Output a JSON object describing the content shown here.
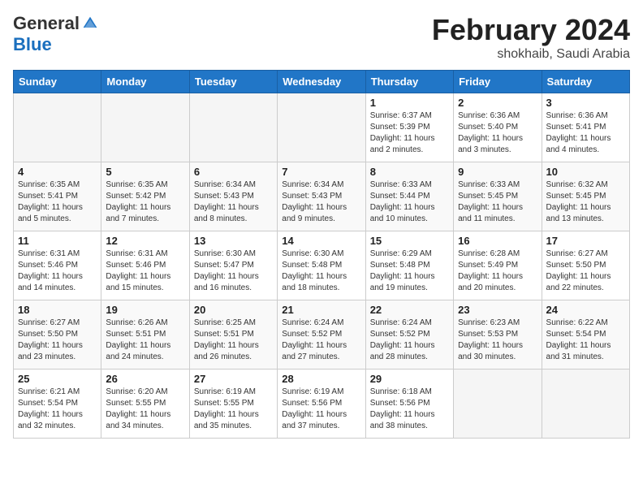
{
  "header": {
    "logo_general": "General",
    "logo_blue": "Blue",
    "title": "February 2024",
    "location": "shokhaib, Saudi Arabia"
  },
  "weekdays": [
    "Sunday",
    "Monday",
    "Tuesday",
    "Wednesday",
    "Thursday",
    "Friday",
    "Saturday"
  ],
  "weeks": [
    [
      {
        "day": "",
        "info": ""
      },
      {
        "day": "",
        "info": ""
      },
      {
        "day": "",
        "info": ""
      },
      {
        "day": "",
        "info": ""
      },
      {
        "day": "1",
        "info": "Sunrise: 6:37 AM\nSunset: 5:39 PM\nDaylight: 11 hours and 2 minutes."
      },
      {
        "day": "2",
        "info": "Sunrise: 6:36 AM\nSunset: 5:40 PM\nDaylight: 11 hours and 3 minutes."
      },
      {
        "day": "3",
        "info": "Sunrise: 6:36 AM\nSunset: 5:41 PM\nDaylight: 11 hours and 4 minutes."
      }
    ],
    [
      {
        "day": "4",
        "info": "Sunrise: 6:35 AM\nSunset: 5:41 PM\nDaylight: 11 hours and 5 minutes."
      },
      {
        "day": "5",
        "info": "Sunrise: 6:35 AM\nSunset: 5:42 PM\nDaylight: 11 hours and 7 minutes."
      },
      {
        "day": "6",
        "info": "Sunrise: 6:34 AM\nSunset: 5:43 PM\nDaylight: 11 hours and 8 minutes."
      },
      {
        "day": "7",
        "info": "Sunrise: 6:34 AM\nSunset: 5:43 PM\nDaylight: 11 hours and 9 minutes."
      },
      {
        "day": "8",
        "info": "Sunrise: 6:33 AM\nSunset: 5:44 PM\nDaylight: 11 hours and 10 minutes."
      },
      {
        "day": "9",
        "info": "Sunrise: 6:33 AM\nSunset: 5:45 PM\nDaylight: 11 hours and 11 minutes."
      },
      {
        "day": "10",
        "info": "Sunrise: 6:32 AM\nSunset: 5:45 PM\nDaylight: 11 hours and 13 minutes."
      }
    ],
    [
      {
        "day": "11",
        "info": "Sunrise: 6:31 AM\nSunset: 5:46 PM\nDaylight: 11 hours and 14 minutes."
      },
      {
        "day": "12",
        "info": "Sunrise: 6:31 AM\nSunset: 5:46 PM\nDaylight: 11 hours and 15 minutes."
      },
      {
        "day": "13",
        "info": "Sunrise: 6:30 AM\nSunset: 5:47 PM\nDaylight: 11 hours and 16 minutes."
      },
      {
        "day": "14",
        "info": "Sunrise: 6:30 AM\nSunset: 5:48 PM\nDaylight: 11 hours and 18 minutes."
      },
      {
        "day": "15",
        "info": "Sunrise: 6:29 AM\nSunset: 5:48 PM\nDaylight: 11 hours and 19 minutes."
      },
      {
        "day": "16",
        "info": "Sunrise: 6:28 AM\nSunset: 5:49 PM\nDaylight: 11 hours and 20 minutes."
      },
      {
        "day": "17",
        "info": "Sunrise: 6:27 AM\nSunset: 5:50 PM\nDaylight: 11 hours and 22 minutes."
      }
    ],
    [
      {
        "day": "18",
        "info": "Sunrise: 6:27 AM\nSunset: 5:50 PM\nDaylight: 11 hours and 23 minutes."
      },
      {
        "day": "19",
        "info": "Sunrise: 6:26 AM\nSunset: 5:51 PM\nDaylight: 11 hours and 24 minutes."
      },
      {
        "day": "20",
        "info": "Sunrise: 6:25 AM\nSunset: 5:51 PM\nDaylight: 11 hours and 26 minutes."
      },
      {
        "day": "21",
        "info": "Sunrise: 6:24 AM\nSunset: 5:52 PM\nDaylight: 11 hours and 27 minutes."
      },
      {
        "day": "22",
        "info": "Sunrise: 6:24 AM\nSunset: 5:52 PM\nDaylight: 11 hours and 28 minutes."
      },
      {
        "day": "23",
        "info": "Sunrise: 6:23 AM\nSunset: 5:53 PM\nDaylight: 11 hours and 30 minutes."
      },
      {
        "day": "24",
        "info": "Sunrise: 6:22 AM\nSunset: 5:54 PM\nDaylight: 11 hours and 31 minutes."
      }
    ],
    [
      {
        "day": "25",
        "info": "Sunrise: 6:21 AM\nSunset: 5:54 PM\nDaylight: 11 hours and 32 minutes."
      },
      {
        "day": "26",
        "info": "Sunrise: 6:20 AM\nSunset: 5:55 PM\nDaylight: 11 hours and 34 minutes."
      },
      {
        "day": "27",
        "info": "Sunrise: 6:19 AM\nSunset: 5:55 PM\nDaylight: 11 hours and 35 minutes."
      },
      {
        "day": "28",
        "info": "Sunrise: 6:19 AM\nSunset: 5:56 PM\nDaylight: 11 hours and 37 minutes."
      },
      {
        "day": "29",
        "info": "Sunrise: 6:18 AM\nSunset: 5:56 PM\nDaylight: 11 hours and 38 minutes."
      },
      {
        "day": "",
        "info": ""
      },
      {
        "day": "",
        "info": ""
      }
    ]
  ]
}
